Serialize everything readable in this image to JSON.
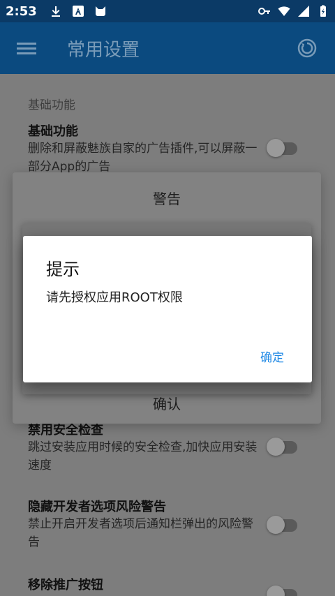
{
  "status_bar": {
    "time": "2:53",
    "icons_left": [
      "download-icon",
      "a-badge-icon",
      "cat-icon"
    ],
    "icons_right": [
      "key-icon",
      "wifi-icon",
      "signal-icon",
      "battery-icon"
    ]
  },
  "app_bar": {
    "title": "常用设置",
    "menu_icon": "menu-icon",
    "action_icon": "refresh-icon"
  },
  "content": {
    "section_header": "基础功能",
    "settings": [
      {
        "title": "基础功能",
        "description": "删除和屏蔽魅族自家的广告插件,可以屏蔽一部分App的广告",
        "enabled": false
      },
      {
        "title": "禁用安全检查",
        "description": "跳过安装应用时候的安全检查,加快应用安装速度",
        "enabled": false
      },
      {
        "title": "隐藏开发者选项风险警告",
        "description": "禁止开启开发者选项后通知栏弹出的风险警告",
        "enabled": false
      },
      {
        "title": "移除推广按钮",
        "description": "",
        "enabled": false
      }
    ]
  },
  "warning_dialog": {
    "title": "警告",
    "confirm_label": "确认"
  },
  "prompt_dialog": {
    "title": "提示",
    "message": "请先授权应用ROOT权限",
    "ok_label": "确定"
  },
  "colors": {
    "status_bar": "#0b3a66",
    "app_bar": "#0b4a7f",
    "accent": "#1e88e5"
  }
}
